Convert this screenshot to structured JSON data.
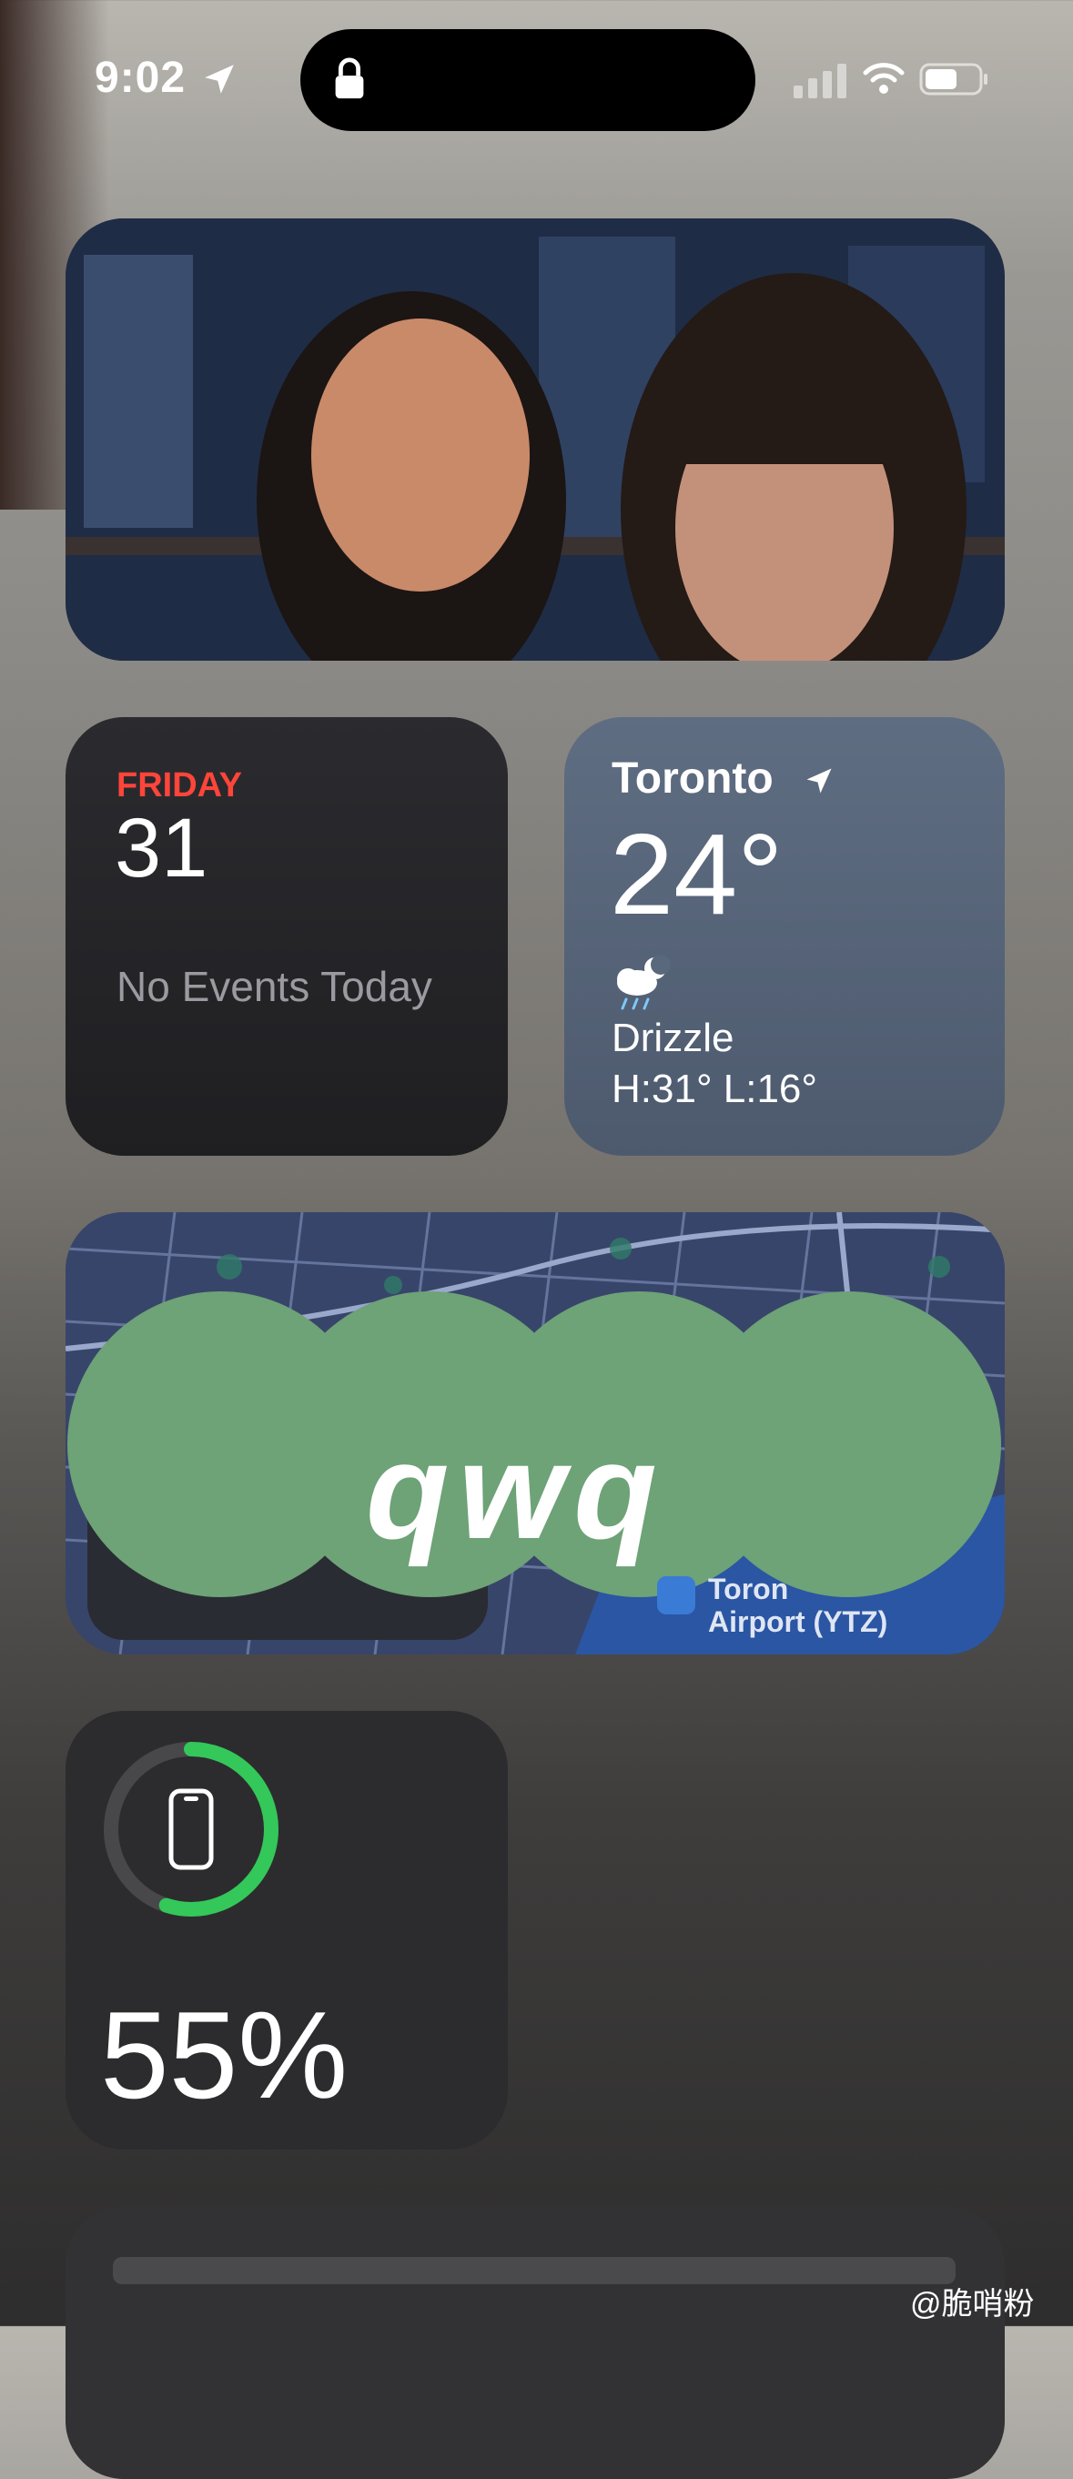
{
  "status_bar": {
    "time": "9:02"
  },
  "calendar": {
    "day": "FRIDAY",
    "date": "31",
    "message": "No Events Today"
  },
  "weather": {
    "city": "Toronto",
    "temp": "24°",
    "condition": "Drizzle",
    "high_low": "H:31° L:16°",
    "icon": "drizzle-icon"
  },
  "map": {
    "overlay_text": "qwq",
    "airport_label_line1": "Toron",
    "airport_label_line2": "Airport (YTZ)"
  },
  "battery": {
    "percent": "55%",
    "level": 0.55,
    "ring_color": "#34c759",
    "icon": "iphone-icon"
  },
  "watermark": {
    "text": "@脆哨粉"
  }
}
